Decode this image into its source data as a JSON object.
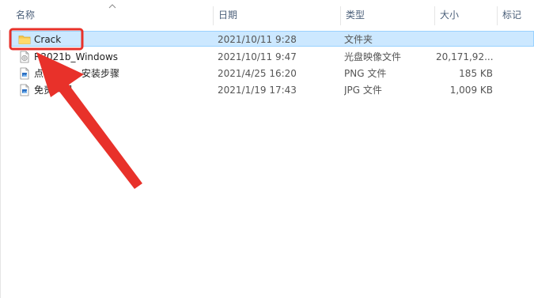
{
  "columns": {
    "name": "名称",
    "date": "日期",
    "type": "类型",
    "size": "大小",
    "tags": "标记"
  },
  "files": [
    {
      "name": "Crack",
      "date": "2021/10/11 9:28",
      "type": "文件夹",
      "size": "",
      "icon": "folder-icon",
      "selected": true
    },
    {
      "name": "R2021b_Windows",
      "date": "2021/10/11 9:47",
      "type": "光盘映像文件",
      "size": "20,171,92...",
      "icon": "disc-image-file-icon",
      "selected": false
    },
    {
      "name": "点我获取 - 安装步骤",
      "date": "2021/4/25 16:20",
      "type": "PNG 文件",
      "size": "185 KB",
      "icon": "image-file-icon",
      "selected": false
    },
    {
      "name": "免责声明",
      "date": "2021/1/19 17:43",
      "type": "JPG 文件",
      "size": "1,009 KB",
      "icon": "image-file-icon",
      "selected": false
    }
  ],
  "colors": {
    "selection_bg": "#cce8ff",
    "selection_border": "#99d1ff",
    "annotation": "#e8312a",
    "folder": "#f5c84c"
  }
}
